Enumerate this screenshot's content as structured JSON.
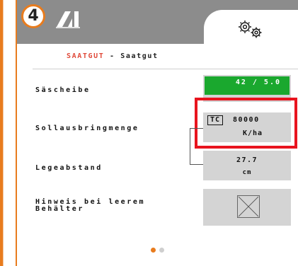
{
  "header": {
    "page_number": "4",
    "logo_icon": "amazone-logo-icon",
    "settings_icon": "gears-icon",
    "background_color": "#8c8c8c",
    "frame_color": "#e87c1e"
  },
  "section": {
    "category": "SAATGUT",
    "separator": " - ",
    "name": "Saatgut"
  },
  "rows": {
    "seeding_disc": {
      "label": "Säscheibe",
      "value": "42 / 5.0",
      "value_bg": "#1aa82e"
    },
    "target_rate": {
      "label": "Sollausbringmenge",
      "badge": "TC",
      "value": "80000",
      "unit": "K/ha",
      "highlight_color": "#e8141e"
    },
    "seed_spacing": {
      "label": "Legeabstand",
      "value": "27.7",
      "unit": "cm"
    },
    "empty_hopper_notice": {
      "label_line1": "Hinweis bei leerem",
      "label_line2": "Behälter",
      "state": "unchecked",
      "icon": "checkbox-crossed-icon"
    }
  },
  "pager": {
    "pages": 2,
    "active_page": 1
  }
}
